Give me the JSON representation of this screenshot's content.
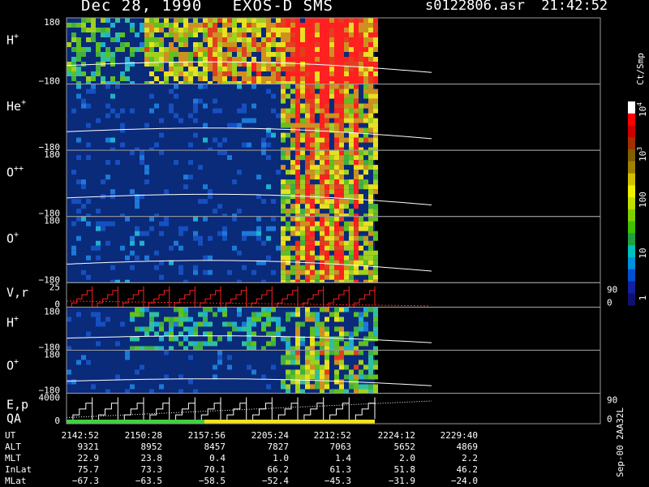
{
  "header": {
    "title": "Dec 28, 1990   EXOS-D SMS",
    "file": "s0122806.asr  21:42:52"
  },
  "colors": {
    "background": "#000000",
    "panel_bg": "#0a2a7a",
    "frame": "#9a9a9a",
    "trace_white": "#ffffff",
    "trace_red": "#ff2020",
    "bar_green": "#40d040",
    "bar_yellow": "#f0e020"
  },
  "chart_data": {
    "type": "heatmap",
    "colorbar": {
      "unit": "Ct/Smp",
      "ticks": [
        "1",
        "10",
        "100",
        "10",
        "10"
      ],
      "tick_superscripts": [
        "",
        "",
        "",
        "3",
        "4"
      ]
    },
    "panels": [
      {
        "label": "H",
        "sup": "+",
        "ytop": "180",
        "ybot": "−180",
        "ratio": 1.0
      },
      {
        "label": "He",
        "sup": "+",
        "ytop": "",
        "ybot": "−180",
        "ratio": 1.0
      },
      {
        "label": "O",
        "sup": "++",
        "ytop": "180",
        "ybot": "−180",
        "ratio": 1.0
      },
      {
        "label": "O",
        "sup": "+",
        "ytop": "180",
        "ybot": "−180",
        "ratio": 1.0
      },
      {
        "label": "V,r",
        "sup": "",
        "ytop": "25",
        "ybot": "0",
        "ratio": 0.37,
        "rtop": "90",
        "rbot": "0"
      },
      {
        "label": "H",
        "sup": "+",
        "ytop": "180",
        "ybot": "−180",
        "ratio": 0.65
      },
      {
        "label": "O",
        "sup": "+",
        "ytop": "180",
        "ybot": "−180",
        "ratio": 0.65
      },
      {
        "label": "E,p",
        "sup": "",
        "label2": "QA",
        "ytop": "4000",
        "ybot": "0",
        "ratio": 0.46,
        "rtop": "90",
        "rbot": "0"
      }
    ],
    "footer": {
      "rows": [
        {
          "label": "UT",
          "values": [
            "2142:52",
            "2150:28",
            "2157:56",
            "2205:24",
            "2212:52",
            "2224:12",
            "2229:40"
          ]
        },
        {
          "label": "ALT",
          "values": [
            "9321",
            "8952",
            "8457",
            "7827",
            "7063",
            "5652",
            "4869"
          ]
        },
        {
          "label": "MLT",
          "values": [
            "22.9",
            "23.8",
            "0.4",
            "1.0",
            "1.4",
            "2.0",
            "2.2"
          ]
        },
        {
          "label": "InLat",
          "values": [
            "75.7",
            "73.3",
            "70.1",
            "66.2",
            "61.3",
            "51.8",
            "46.2"
          ]
        },
        {
          "label": "MLat",
          "values": [
            "−67.3",
            "−63.5",
            "−58.5",
            "−52.4",
            "−45.3",
            "−31.9",
            "−24.0"
          ]
        }
      ]
    },
    "side_label": "Sep-00  2AA32L"
  }
}
